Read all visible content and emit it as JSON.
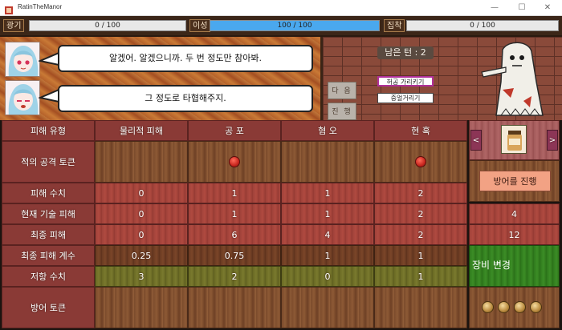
{
  "window": {
    "title": "RatinTheManor",
    "minimize": "—",
    "maximize": "☐",
    "close": "✕"
  },
  "stats": {
    "madness": {
      "label": "광기",
      "text": "0 / 100",
      "fill": 0,
      "color": "#e8e8e8"
    },
    "reason": {
      "label": "이성",
      "text": "100 / 100",
      "fill": 1.0,
      "color": "#4aa8ee"
    },
    "obsession": {
      "label": "집착",
      "text": "0 / 100",
      "fill": 0,
      "color": "#e8e8e8"
    }
  },
  "dialogue": {
    "line1": "알겠어. 알겠으니까. 두 번 정도만 참아봐.",
    "line2": "그 정도로 타협해주지."
  },
  "nav": {
    "next": "다 음",
    "proceed": "진 행"
  },
  "turns": {
    "text": "남은 턴 : 2"
  },
  "enemy_skills": [
    "허공 가리키기",
    "중얼거리기"
  ],
  "table": {
    "header": [
      "피해 유형",
      "물리적 피해",
      "공 포",
      "혐 오",
      "현 혹"
    ],
    "rows": [
      {
        "label": "적의 공격 토큰",
        "values": [
          "",
          "",
          "",
          ""
        ],
        "tokens": [
          false,
          true,
          false,
          true
        ]
      },
      {
        "label": "피해 수치",
        "values": [
          "0",
          "1",
          "1",
          "2"
        ]
      },
      {
        "label": "현재 기술 피해",
        "values": [
          "0",
          "1",
          "1",
          "2"
        ],
        "side": "4"
      },
      {
        "label": "최종 피해",
        "values": [
          "0",
          "6",
          "4",
          "2"
        ],
        "side": "12"
      },
      {
        "label": "최종 피해 계수",
        "values": [
          "0.25",
          "0.75",
          "1",
          "1"
        ]
      },
      {
        "label": "저항 수치",
        "values": [
          "3",
          "2",
          "0",
          "1"
        ]
      },
      {
        "label": "방어 토큰",
        "values": [
          "",
          "",
          "",
          ""
        ]
      }
    ]
  },
  "side": {
    "prev_arrow": "<",
    "next_arrow": ">",
    "defend_button": "방어를 진행",
    "equip_label": "장비 변경",
    "coins": 4
  },
  "colors": {
    "reason_bar": "#4aa8ee",
    "accent_red": "#8a3a36",
    "wood": "#7b4b2c",
    "button_salmon": "#f2a284"
  }
}
